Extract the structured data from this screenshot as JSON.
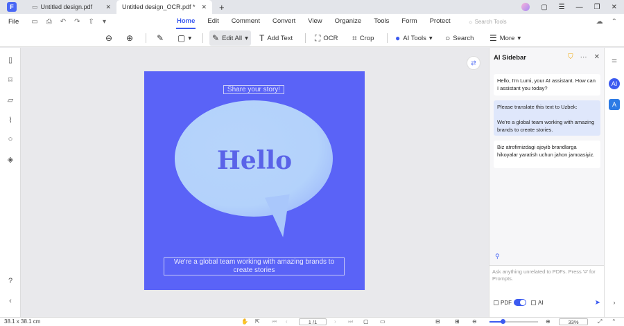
{
  "tabs": [
    {
      "label": "Untitled design.pdf"
    },
    {
      "label": "Untitled design_OCR.pdf *"
    }
  ],
  "menubar": {
    "file": "File",
    "menus": [
      "Home",
      "Edit",
      "Comment",
      "Convert",
      "View",
      "Organize",
      "Tools",
      "Form",
      "Protect"
    ],
    "active": "Home",
    "search_placeholder": "Search Tools"
  },
  "toolbar": {
    "edit_all": "Edit All",
    "add_text": "Add Text",
    "ocr": "OCR",
    "crop": "Crop",
    "ai_tools": "AI Tools",
    "search": "Search",
    "more": "More"
  },
  "page": {
    "header_text": "Share your story!",
    "hello": "Hello",
    "caption": "We're a global team working with amazing brands to create stories"
  },
  "sidebar": {
    "title": "AI Sidebar",
    "messages": [
      {
        "role": "assistant",
        "text": "Hello, I'm Lumi, your AI assistant. How can I assistant you today?"
      },
      {
        "role": "user",
        "text": "Please translate this text to Uzbek:\n\nWe're a global team working with amazing brands to create stories."
      },
      {
        "role": "assistant",
        "text": "Biz atrofimizdagi ajoyib brandlarga hikoyalar yaratish uchun jahon jamoasiyiz."
      }
    ],
    "input_placeholder": "Ask anything unrelated to PDFs. Press '#' for Prompts.",
    "pdf_label": "PDF",
    "ai_label": "AI"
  },
  "statusbar": {
    "dimensions": "38.1 x 38.1 cm",
    "page": "1 /1",
    "zoom": "33%"
  },
  "colors": {
    "accent": "#3c5bf0",
    "page_bg": "#5a63f7"
  }
}
